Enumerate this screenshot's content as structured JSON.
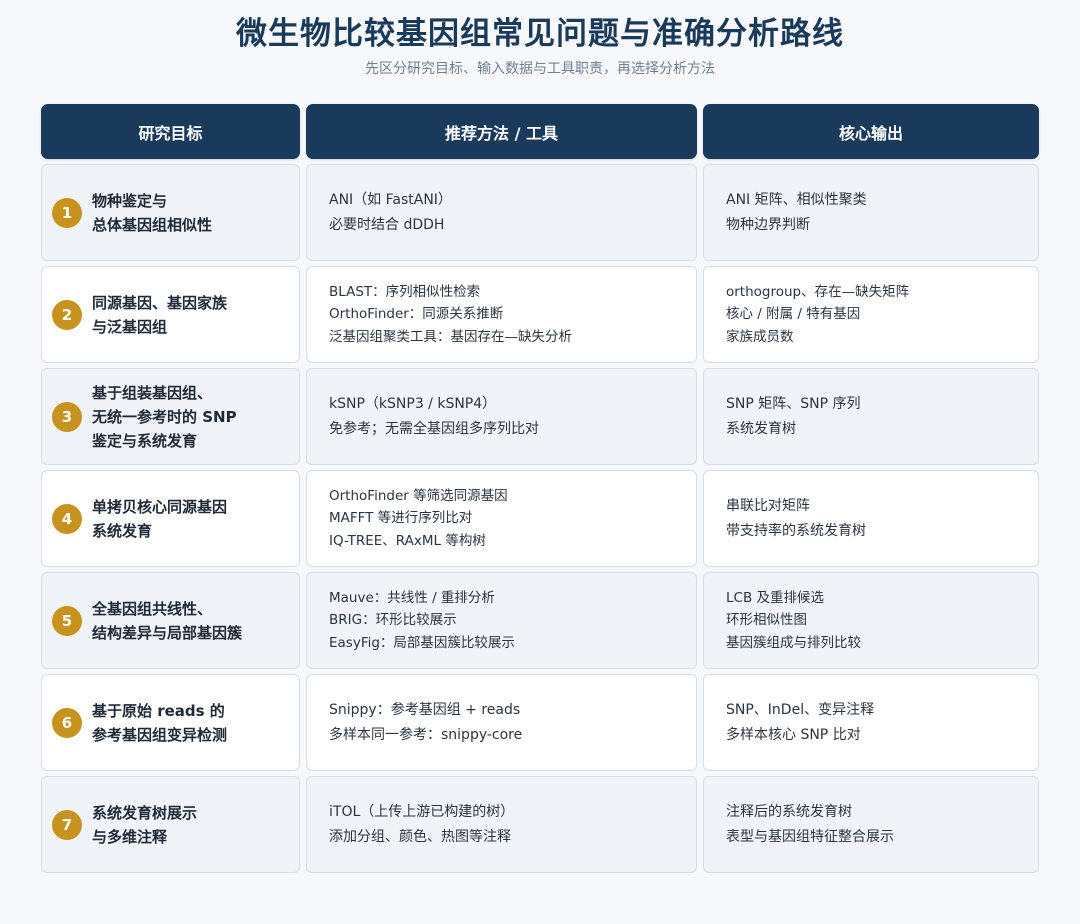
{
  "header": {
    "title": "微生物比较基因组常见问题与准确分析路线",
    "subtitle": "先区分研究目标、输入数据与工具职责，再选择分析方法"
  },
  "columns": [
    "研究目标",
    "推荐方法 / 工具",
    "核心输出"
  ],
  "rows": [
    {
      "num": "1",
      "goal": [
        "物种鉴定与",
        "总体基因组相似性"
      ],
      "methods": [
        "ANI（如 FastANI）",
        "必要时结合 dDDH"
      ],
      "outputs": [
        "ANI 矩阵、相似性聚类",
        "物种边界判断"
      ]
    },
    {
      "num": "2",
      "goal": [
        "同源基因、基因家族",
        "与泛基因组"
      ],
      "methods": [
        "BLAST：序列相似性检索",
        "OrthoFinder：同源关系推断",
        "泛基因组聚类工具：基因存在—缺失分析"
      ],
      "outputs": [
        "orthogroup、存在—缺失矩阵",
        "核心 / 附属 / 特有基因",
        "家族成员数"
      ]
    },
    {
      "num": "3",
      "goal": [
        "基于组装基因组、",
        "无统一参考时的 SNP",
        "鉴定与系统发育"
      ],
      "methods": [
        "kSNP（kSNP3 / kSNP4）",
        "免参考；无需全基因组多序列比对"
      ],
      "outputs": [
        "SNP 矩阵、SNP 序列",
        "系统发育树"
      ]
    },
    {
      "num": "4",
      "goal": [
        "单拷贝核心同源基因",
        "系统发育"
      ],
      "methods": [
        "OrthoFinder 等筛选同源基因",
        "MAFFT 等进行序列比对",
        "IQ-TREE、RAxML 等构树"
      ],
      "outputs": [
        "串联比对矩阵",
        "带支持率的系统发育树"
      ]
    },
    {
      "num": "5",
      "goal": [
        "全基因组共线性、",
        "结构差异与局部基因簇"
      ],
      "methods": [
        "Mauve：共线性 / 重排分析",
        "BRIG：环形比较展示",
        "EasyFig：局部基因簇比较展示"
      ],
      "outputs": [
        "LCB 及重排候选",
        "环形相似性图",
        "基因簇组成与排列比较"
      ]
    },
    {
      "num": "6",
      "goal": [
        "基于原始 reads 的",
        "参考基因组变异检测"
      ],
      "methods": [
        "Snippy：参考基因组 + reads",
        "多样本同一参考：snippy-core"
      ],
      "outputs": [
        "SNP、InDel、变异注释",
        "多样本核心 SNP 比对"
      ]
    },
    {
      "num": "7",
      "goal": [
        "系统发育树展示",
        "与多维注释"
      ],
      "methods": [
        "iTOL（上传上游已构建的树）",
        "添加分组、颜色、热图等注释"
      ],
      "outputs": [
        "注释后的系统发育树",
        "表型与基因组特征整合展示"
      ]
    }
  ],
  "colors": {
    "header_bg": "#1a3a5c",
    "badge": "#c8921e",
    "row_alt": "#f0f3f7",
    "row_plain": "#ffffff"
  }
}
